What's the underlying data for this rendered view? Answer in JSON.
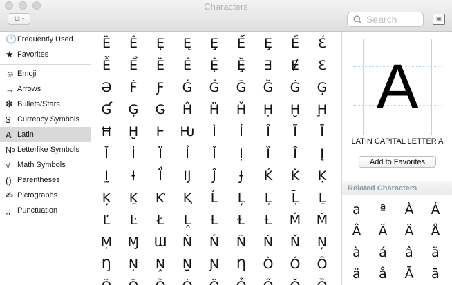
{
  "window": {
    "title": "Characters"
  },
  "toolbar": {
    "gear_glyph": "⚙",
    "caret": "▾",
    "search_placeholder": "Search",
    "view_toggle_glyph": "⌘"
  },
  "sidebar": {
    "groups": [
      [
        {
          "icon": "🕘",
          "icon_name": "clock-icon",
          "label": "Frequently Used"
        },
        {
          "icon": "★",
          "icon_name": "star-icon",
          "label": "Favorites"
        }
      ],
      [
        {
          "icon": "☺",
          "icon_name": "smiley-icon",
          "label": "Emoji"
        },
        {
          "icon": "→",
          "icon_name": "arrow-icon",
          "label": "Arrows"
        },
        {
          "icon": "✻",
          "icon_name": "asterisk-icon",
          "label": "Bullets/Stars"
        },
        {
          "icon": "$",
          "icon_name": "dollar-icon",
          "label": "Currency Symbols"
        },
        {
          "icon": "A",
          "icon_name": "latin-a-icon",
          "label": "Latin",
          "selected": true
        },
        {
          "icon": "№",
          "icon_name": "numero-icon",
          "label": "Letterlike Symbols"
        },
        {
          "icon": "√",
          "icon_name": "square-root-icon",
          "label": "Math Symbols"
        },
        {
          "icon": "()",
          "icon_name": "parentheses-icon",
          "label": "Parentheses"
        },
        {
          "icon": "✍",
          "icon_name": "writing-hand-icon",
          "label": "Pictographs"
        },
        {
          "icon": ",,",
          "icon_name": "punctuation-icon",
          "label": "Punctuation"
        }
      ]
    ]
  },
  "grid": {
    "rows": [
      [
        "Ȅ",
        "Ê",
        "Ẹ",
        "Ę",
        "Ȩ",
        "Ế",
        "Ȩ",
        "Ề",
        "Ɛ́"
      ],
      [
        "Ễ",
        "Ể",
        "Ȅ",
        "É",
        "Ệ",
        "Ḝ",
        "Ǝ",
        "Ɇ",
        "Ɛ"
      ],
      [
        "Ə",
        "Ḟ",
        "Ƒ",
        "Ǵ",
        "Ĝ",
        "Ḡ",
        "Ğ",
        "Ġ",
        "Ģ"
      ],
      [
        "Ɠ",
        "Ģ",
        "Ǥ",
        "Ĥ",
        "Ḧ",
        "Ȟ",
        "Ḥ",
        "Ḫ",
        "Ḩ"
      ],
      [
        "Ħ",
        "Ḫ",
        "Ⱶ",
        "Ƕ",
        "Ì",
        "Í",
        "Î",
        "Ĩ",
        "Ī"
      ],
      [
        "Ĭ",
        "İ",
        "Ï",
        "Ỉ",
        "Ǐ",
        "Ị",
        "Ȉ",
        "Ȋ",
        "Į"
      ],
      [
        "Ḭ",
        "Ɨ",
        "Ḯ",
        "Ĳ",
        "Ĵ",
        "Ɉ",
        "Ḱ",
        "Ǩ",
        "Ḳ"
      ],
      [
        "Ķ",
        "Ḵ",
        "Ƙ",
        "Ⱪ",
        "Ĺ",
        "Ļ",
        "Ḷ",
        "Ḹ",
        "Ḻ"
      ],
      [
        "Ľ",
        "Ŀ",
        "Ł",
        "Ḽ",
        "Ƚ",
        "Ɫ",
        "Ƚ",
        "Ḿ",
        "Ṁ"
      ],
      [
        "Ṃ",
        "Ɱ",
        "Ɯ",
        "Ǹ",
        "Ń",
        "Ñ",
        "Ṅ",
        "Ň",
        "Ņ"
      ],
      [
        "Ŋ",
        "Ṇ",
        "Ṋ",
        "Ṉ",
        "Ɲ",
        "Ƞ",
        "Ò",
        "Ó",
        "Ô"
      ],
      [
        "Õ",
        "Ō",
        "Ŏ",
        "Ȯ",
        "Ö",
        "Ỏ",
        "Ő",
        "Ǒ",
        "Ȍ"
      ]
    ]
  },
  "detail": {
    "glyph": "A",
    "name": "LATIN CAPITAL LETTER A",
    "favorite_label": "Add to Favorites",
    "related_title": "Related Characters",
    "related_rows": [
      [
        "a",
        "ª",
        "À",
        "Á"
      ],
      [
        "Â",
        "Ã",
        "Ä",
        "Å"
      ],
      [
        "à",
        "á",
        "â",
        "ã"
      ],
      [
        "ä",
        "å",
        "Ā",
        "ā"
      ]
    ]
  }
}
